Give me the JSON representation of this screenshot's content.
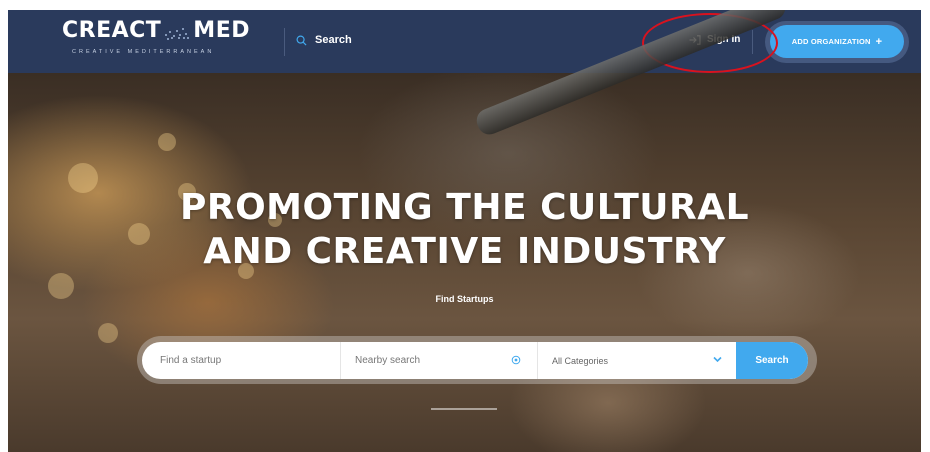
{
  "header": {
    "logo_text_left": "CREACT",
    "logo_text_right": "MED",
    "logo_tagline": "CREATIVE MEDITERRANEAN",
    "search_label": "Search",
    "signin_label": "Sign In",
    "add_org_label": "ADD ORGANIZATION",
    "add_org_icon": "plus-icon"
  },
  "hero": {
    "title_line1": "PROMOTING THE CULTURAL",
    "title_line2": "AND CREATIVE INDUSTRY",
    "subtitle": "Find Startups"
  },
  "search_bar": {
    "startup_placeholder": "Find a startup",
    "nearby_placeholder": "Nearby search",
    "category_selected": "All Categories",
    "submit_label": "Search"
  },
  "colors": {
    "header_bg": "#2a3a5c",
    "accent": "#41a9ee",
    "annotation": "#d9121e"
  }
}
